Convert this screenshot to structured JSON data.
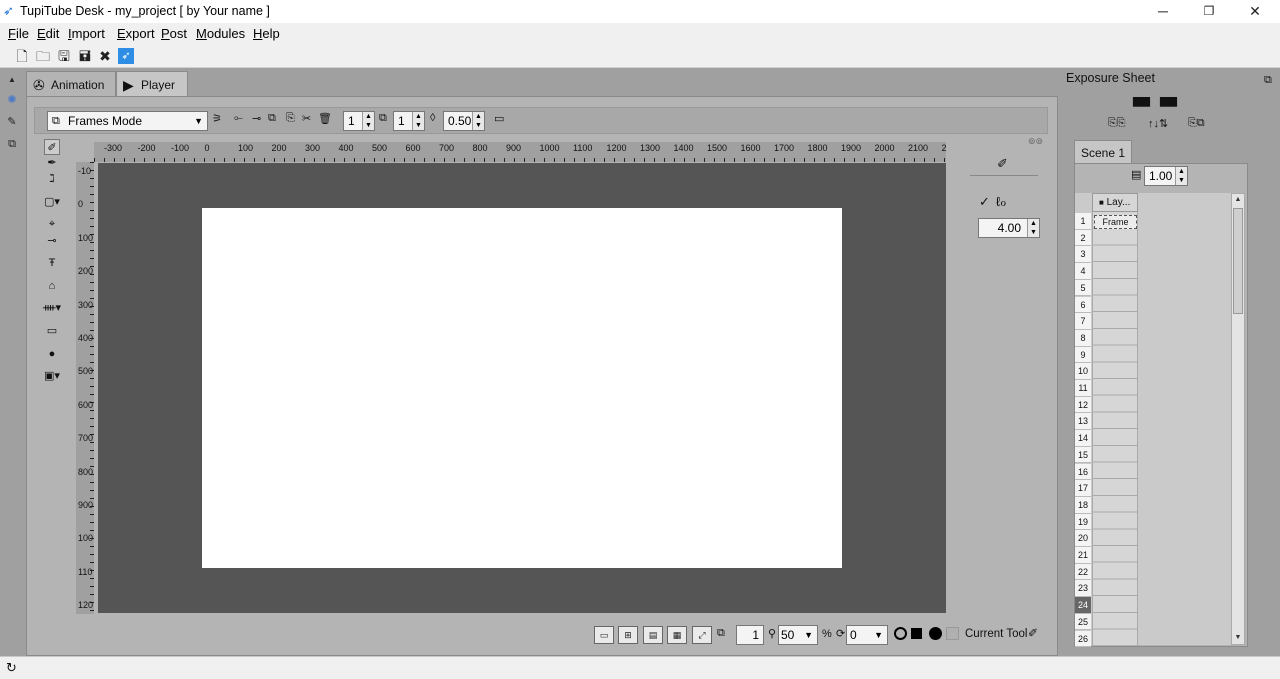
{
  "window": {
    "title": "TupiTube Desk - my_project [ by Your name ]",
    "minimize": "─",
    "restore": "❐",
    "close": "✕"
  },
  "menu": [
    "File",
    "Edit",
    "Import",
    "Export",
    "Post",
    "Modules",
    "Help"
  ],
  "tabs": {
    "animation": "Animation",
    "player": "Player"
  },
  "modebar": {
    "mode": "Frames Mode",
    "spin1": "1",
    "spin2": "1",
    "opacity": "0.50"
  },
  "ruler": {
    "h": [
      "-300",
      "-200",
      "-100",
      "0",
      "100",
      "200",
      "300",
      "400",
      "500",
      "600",
      "700",
      "800",
      "900",
      "1000",
      "1100",
      "1200",
      "1300",
      "1400",
      "1500",
      "1600",
      "1700",
      "1800",
      "1900",
      "2000",
      "2100",
      "2"
    ],
    "v": [
      "-10",
      "0",
      "100",
      "200",
      "300",
      "400",
      "500",
      "600",
      "700",
      "800",
      "900",
      "100",
      "110",
      "120"
    ]
  },
  "pen": {
    "size": "4.00"
  },
  "bottombar": {
    "frame": "1",
    "zoom": "50",
    "percent": "%",
    "rotation": "0",
    "current_tool": "Current Tool"
  },
  "exposure": {
    "title": "Exposure Sheet",
    "scene": "Scene 1",
    "fps": "1.00",
    "layer": "Lay...",
    "frame": "Frame",
    "rows": [
      "1",
      "2",
      "3",
      "4",
      "5",
      "6",
      "7",
      "8",
      "9",
      "10",
      "11",
      "12",
      "13",
      "14",
      "15",
      "16",
      "17",
      "18",
      "19",
      "20",
      "21",
      "22",
      "23",
      "24",
      "25",
      "26"
    ],
    "highlight_row": "24"
  }
}
